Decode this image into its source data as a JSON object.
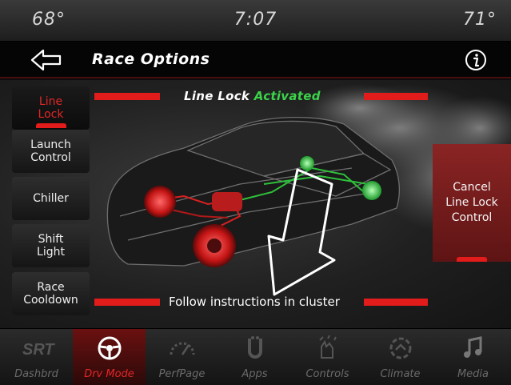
{
  "status_bar": {
    "temp_left": "68°",
    "time": "7:07",
    "temp_right": "71°"
  },
  "header": {
    "title": "Race Options",
    "back_icon": "back-arrow-icon",
    "info_icon": "info-icon"
  },
  "side_menu": [
    {
      "label": "Line\nLock",
      "active": true
    },
    {
      "label": "Launch\nControl",
      "active": false
    },
    {
      "label": "Chiller",
      "active": false
    },
    {
      "label": "Shift\nLight",
      "active": false
    },
    {
      "label": "Race\nCooldown",
      "active": false
    }
  ],
  "status": {
    "prefix": "Line Lock",
    "state": "Activated",
    "state_color": "#3bd34a"
  },
  "cancel_button": {
    "label": "Cancel\nLine Lock\nControl"
  },
  "instruction": "Follow instructions in cluster",
  "colors": {
    "accent": "#e21b1b",
    "active_green": "#3bd34a"
  },
  "bottom_nav": [
    {
      "label": "Dashbrd",
      "icon": "srt-logo-icon",
      "active": false
    },
    {
      "label": "Drv Mode",
      "icon": "steering-wheel-icon",
      "active": true
    },
    {
      "label": "PerfPage",
      "icon": "gauge-icon",
      "active": false
    },
    {
      "label": "Apps",
      "icon": "apps-icon",
      "active": false
    },
    {
      "label": "Controls",
      "icon": "controls-icon",
      "active": false
    },
    {
      "label": "Climate",
      "icon": "climate-icon",
      "active": false
    },
    {
      "label": "Media",
      "icon": "music-note-icon",
      "active": false
    }
  ],
  "logo_text": "SRT"
}
